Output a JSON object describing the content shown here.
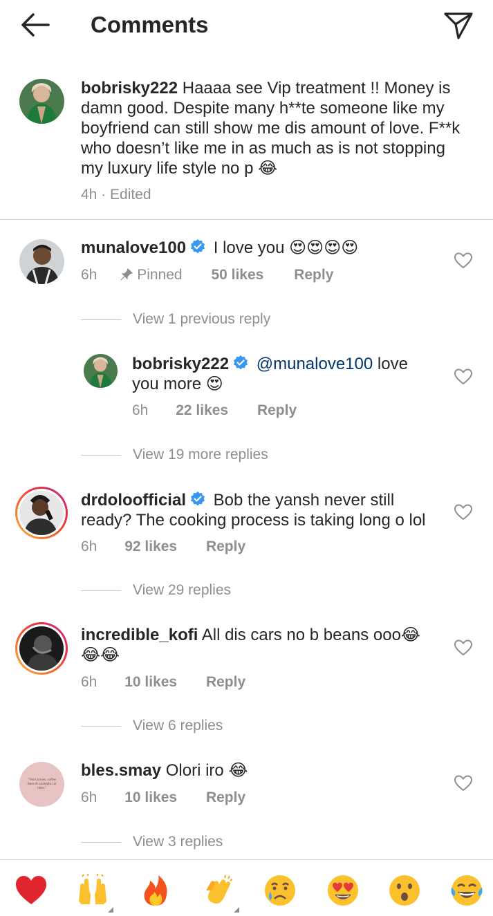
{
  "header": {
    "title": "Comments",
    "back_icon": "arrow-left-icon",
    "share_icon": "paper-plane-icon"
  },
  "caption": {
    "username": "bobrisky222",
    "text": "Haaaa see Vip treatment !! Money is damn good. Despite many h**te someone like my boyfriend can still show me dis amount of love. F**k who doesn’t like me in as much as is not stopping my luxury life style no p",
    "emoji": "😂",
    "meta": "4h · Edited"
  },
  "comments": [
    {
      "username": "munalove100",
      "verified": true,
      "text": "I love you",
      "emojis": "😍😍😍😍",
      "time": "6h",
      "pinned_label": "Pinned",
      "likes": "50 likes",
      "reply_label": "Reply",
      "view_replies": "View 1 previous reply",
      "reply": {
        "username": "bobrisky222",
        "verified": true,
        "mention": "@munalove100",
        "text": "love you more",
        "emoji": "😍",
        "time": "6h",
        "likes": "22 likes",
        "reply_label": "Reply"
      },
      "view_more": "View 19 more replies"
    },
    {
      "username": "drdoloofficial",
      "verified": true,
      "text": "Bob the yansh never still ready? The cooking process is taking long o lol",
      "time": "6h",
      "likes": "92 likes",
      "reply_label": "Reply",
      "view_replies": "View 29 replies"
    },
    {
      "username": "incredible_kofi",
      "verified": false,
      "text": "All dis cars no b beans ooo",
      "emojis": "😂😂😂",
      "time": "6h",
      "likes": "10 likes",
      "reply_label": "Reply",
      "view_replies": "View 6 replies"
    },
    {
      "username": "bles.smay",
      "verified": false,
      "text": "Olori iro",
      "emojis": "😂",
      "time": "6h",
      "likes": "10 likes",
      "reply_label": "Reply",
      "view_replies": "View 3 replies",
      "avatar_text": "\"Neck kisses, coffee dates & midnight car rides.\""
    }
  ],
  "emoji_bar": [
    "❤️",
    "🙌",
    "🔥",
    "👏",
    "😢",
    "😍",
    "😮",
    "😂"
  ],
  "colors": {
    "text": "#262626",
    "secondary": "#8e8e8e",
    "verified": "#3897f0",
    "mention": "#00376b"
  }
}
